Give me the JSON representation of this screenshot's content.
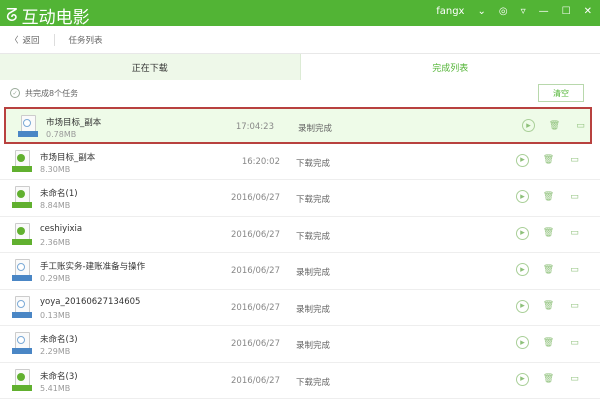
{
  "app": {
    "title": "互动电影",
    "user": "fangx"
  },
  "breadcrumb": {
    "back": "返回",
    "current": "任务列表"
  },
  "tabs": [
    {
      "label": "正在下载"
    },
    {
      "label": "完成列表"
    }
  ],
  "summary": {
    "text": "共完成8个任务",
    "clear_label": "清空"
  },
  "tasks": [
    {
      "name": "市场目标_副本",
      "size": "0.78MB",
      "time": "17:04:23",
      "status": "录制完成",
      "icon": "blue",
      "selected": true
    },
    {
      "name": "市场目标_副本",
      "size": "8.30MB",
      "time": "16:20:02",
      "status": "下载完成",
      "icon": "green"
    },
    {
      "name": "未命名(1)",
      "size": "8.84MB",
      "time": "2016/06/27",
      "status": "下载完成",
      "icon": "green"
    },
    {
      "name": "ceshiyixia",
      "size": "2.36MB",
      "time": "2016/06/27",
      "status": "下载完成",
      "icon": "green"
    },
    {
      "name": "手工账实务-建账准备与操作",
      "size": "0.29MB",
      "time": "2016/06/27",
      "status": "录制完成",
      "icon": "blue"
    },
    {
      "name": "yoya_20160627134605",
      "size": "0.13MB",
      "time": "2016/06/27",
      "status": "录制完成",
      "icon": "blue"
    },
    {
      "name": "未命名(3)",
      "size": "2.29MB",
      "time": "2016/06/27",
      "status": "录制完成",
      "icon": "blue"
    },
    {
      "name": "未命名(3)",
      "size": "5.41MB",
      "time": "2016/06/27",
      "status": "下载完成",
      "icon": "green"
    }
  ]
}
